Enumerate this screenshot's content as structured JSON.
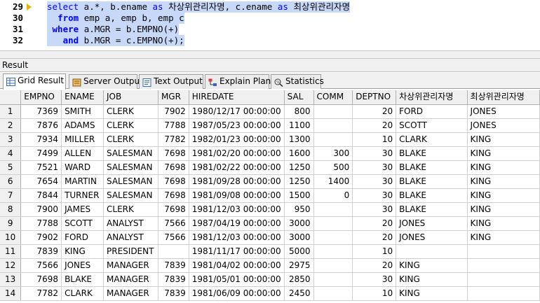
{
  "editor": {
    "lines": [
      {
        "num": "29",
        "current": true,
        "parts": [
          {
            "t": "select",
            "c": "kw"
          },
          {
            "t": " a.*, b.ename ",
            "c": ""
          },
          {
            "t": "as",
            "c": "kw"
          },
          {
            "t": " 차상위관리자명, c.ename ",
            "c": ""
          },
          {
            "t": "as",
            "c": "kw"
          },
          {
            "t": " 최상위관리자명",
            "c": ""
          }
        ]
      },
      {
        "num": "30",
        "current": false,
        "parts": [
          {
            "t": "  ",
            "c": ""
          },
          {
            "t": "from",
            "c": "kwb"
          },
          {
            "t": " emp a, emp b, emp c",
            "c": ""
          }
        ]
      },
      {
        "num": "31",
        "current": false,
        "parts": [
          {
            "t": " ",
            "c": ""
          },
          {
            "t": "where",
            "c": "kwb"
          },
          {
            "t": " a.MGR = b.EMPNO(+)",
            "c": ""
          }
        ]
      },
      {
        "num": "32",
        "current": false,
        "parts": [
          {
            "t": "   ",
            "c": ""
          },
          {
            "t": "and",
            "c": "kwb"
          },
          {
            "t": " b.MGR = c.EMPNO(+);",
            "c": ""
          }
        ]
      }
    ]
  },
  "result": {
    "title": "Result",
    "tabs": [
      {
        "label": "Grid Result",
        "icon": "grid-icon",
        "active": true
      },
      {
        "label": "Server Output",
        "icon": "server-output-icon",
        "active": false
      },
      {
        "label": "Text Output",
        "icon": "text-output-icon",
        "active": false
      },
      {
        "label": "Explain Plan",
        "icon": "explain-plan-icon",
        "active": false
      },
      {
        "label": "Statistics",
        "icon": "statistics-icon",
        "active": false
      }
    ]
  },
  "grid": {
    "columns": [
      "EMPNO",
      "ENAME",
      "JOB",
      "MGR",
      "HIREDATE",
      "SAL",
      "COMM",
      "DEPTNO",
      "차상위관리자명",
      "최상위관리자명"
    ],
    "numeric": [
      true,
      false,
      false,
      true,
      false,
      true,
      true,
      true,
      false,
      false
    ],
    "rows": [
      [
        "1",
        "7369",
        "SMITH",
        "CLERK",
        "7902",
        "1980/12/17 00:00:00",
        "800",
        "",
        "20",
        "FORD",
        "JONES"
      ],
      [
        "2",
        "7876",
        "ADAMS",
        "CLERK",
        "7788",
        "1987/05/23 00:00:00",
        "1100",
        "",
        "20",
        "SCOTT",
        "JONES"
      ],
      [
        "3",
        "7934",
        "MILLER",
        "CLERK",
        "7782",
        "1982/01/23 00:00:00",
        "1300",
        "",
        "10",
        "CLARK",
        "KING"
      ],
      [
        "4",
        "7499",
        "ALLEN",
        "SALESMAN",
        "7698",
        "1981/02/20 00:00:00",
        "1600",
        "300",
        "30",
        "BLAKE",
        "KING"
      ],
      [
        "5",
        "7521",
        "WARD",
        "SALESMAN",
        "7698",
        "1981/02/22 00:00:00",
        "1250",
        "500",
        "30",
        "BLAKE",
        "KING"
      ],
      [
        "6",
        "7654",
        "MARTIN",
        "SALESMAN",
        "7698",
        "1981/09/28 00:00:00",
        "1250",
        "1400",
        "30",
        "BLAKE",
        "KING"
      ],
      [
        "7",
        "7844",
        "TURNER",
        "SALESMAN",
        "7698",
        "1981/09/08 00:00:00",
        "1500",
        "0",
        "30",
        "BLAKE",
        "KING"
      ],
      [
        "8",
        "7900",
        "JAMES",
        "CLERK",
        "7698",
        "1981/12/03 00:00:00",
        "950",
        "",
        "30",
        "BLAKE",
        "KING"
      ],
      [
        "9",
        "7788",
        "SCOTT",
        "ANALYST",
        "7566",
        "1987/04/19 00:00:00",
        "3000",
        "",
        "20",
        "JONES",
        "KING"
      ],
      [
        "10",
        "7902",
        "FORD",
        "ANALYST",
        "7566",
        "1981/12/03 00:00:00",
        "3000",
        "",
        "20",
        "JONES",
        "KING"
      ],
      [
        "11",
        "7839",
        "KING",
        "PRESIDENT",
        "",
        "1981/11/17 00:00:00",
        "5000",
        "",
        "10",
        "",
        ""
      ],
      [
        "12",
        "7566",
        "JONES",
        "MANAGER",
        "7839",
        "1981/04/02 00:00:00",
        "2975",
        "",
        "20",
        "KING",
        ""
      ],
      [
        "13",
        "7698",
        "BLAKE",
        "MANAGER",
        "7839",
        "1981/05/01 00:00:00",
        "2850",
        "",
        "30",
        "KING",
        ""
      ],
      [
        "14",
        "7782",
        "CLARK",
        "MANAGER",
        "7839",
        "1981/06/09 00:00:00",
        "2450",
        "",
        "10",
        "KING",
        ""
      ]
    ]
  }
}
